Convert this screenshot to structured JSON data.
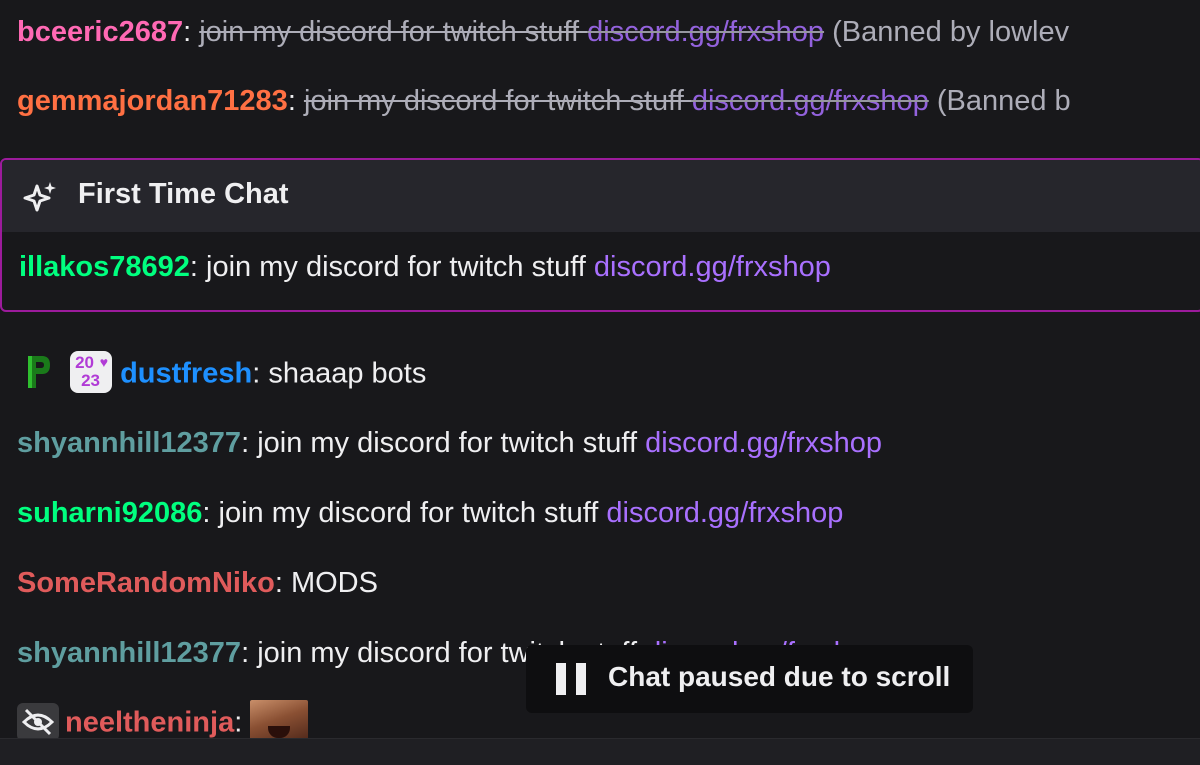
{
  "colors": {
    "background": "#18181b",
    "link": "#a970ff",
    "first_time_border": "#9c1b9c",
    "pink_user": "#ff69b4",
    "orange_user": "#ff7043",
    "green_user": "#00ff7f",
    "blue_user": "#1e90ff",
    "teal_user": "#5f9ea0",
    "red_user": "#e05b5b"
  },
  "messages": [
    {
      "user": "bceeric2687",
      "text": "join my discord for twitch stuff ",
      "link": "discord.gg/frxshop",
      "status": "(Banned by lowlev",
      "deleted": true
    },
    {
      "user": "gemmajordan71283",
      "text": "join my discord for twitch stuff ",
      "link": "discord.gg/frxshop",
      "status": "(Banned b",
      "deleted": true
    }
  ],
  "first_time_chat": {
    "title": "First Time Chat",
    "icon": "sparkle-icon",
    "user": "illakos78692",
    "text": "join my discord for twitch stuff ",
    "link": "discord.gg/frxshop"
  },
  "chat": [
    {
      "user": "dustfresh",
      "text": "shaaap bots",
      "badges": [
        "p-badge-icon",
        "2023-badge-icon"
      ],
      "badge_2023_top": "20",
      "badge_2023_bottom": "23"
    },
    {
      "user": "shyannhill12377",
      "text": "join my discord for twitch stuff ",
      "link": "discord.gg/frxshop"
    },
    {
      "user": "suharni92086",
      "text": "join my discord for twitch stuff ",
      "link": "discord.gg/frxshop"
    },
    {
      "user": "SomeRandomNiko",
      "text": "MODS"
    },
    {
      "user": "shyannhill12377",
      "text": "join my discord for twitch stuff ",
      "link": "discord.gg/frxshop"
    },
    {
      "user": "neeltheninja",
      "text": "",
      "badges": [
        "hidden-eye-icon"
      ],
      "emote": "face-emote"
    }
  ],
  "separator": ":",
  "pause_notice": {
    "icon": "pause-icon",
    "text": "Chat paused due to scroll"
  }
}
